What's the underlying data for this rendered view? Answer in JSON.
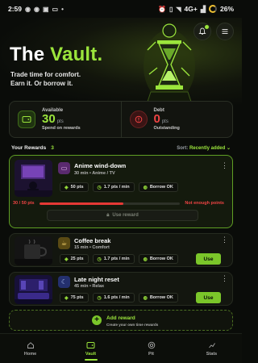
{
  "status_bar": {
    "time": "2:59",
    "signal": "4G+",
    "battery": "26%"
  },
  "hero": {
    "title_main": "The ",
    "title_accent": "Vault.",
    "subtitle_line1": "Trade time for comfort.",
    "subtitle_line2": "Earn it. Or borrow it."
  },
  "stats": {
    "available": {
      "label": "Available",
      "value": "30",
      "unit": "pts",
      "caption": "Spend on rewards"
    },
    "debt": {
      "label": "Debt",
      "value": "0",
      "unit": "pts",
      "caption": "Outstanding"
    }
  },
  "rewards_header": {
    "title": "Your Rewards",
    "count": "3",
    "sort_label": "Sort: ",
    "sort_value": "Recently added"
  },
  "rewards": [
    {
      "title": "Anime wind-down",
      "meta": "30 min • Anime / TV",
      "cost": "50 pts",
      "rate": "1.7 pts / min",
      "borrow": "Borrow OK",
      "progress_text": "30 / 50 pts",
      "progress_fraction": 0.6,
      "warning": "Not enough points",
      "action": "Use reward"
    },
    {
      "title": "Coffee break",
      "meta": "15 min • Comfort",
      "cost": "25 pts",
      "rate": "1.7 pts / min",
      "borrow": "Borrow OK",
      "action": "Use"
    },
    {
      "title": "Late night reset",
      "meta": "45 min • Relax",
      "cost": "75 pts",
      "rate": "1.6 pts / min",
      "borrow": "Borrow OK",
      "action": "Use"
    }
  ],
  "add_reward": {
    "title": "Add reward",
    "subtitle": "Create your own time rewards"
  },
  "nav": [
    {
      "label": "Home"
    },
    {
      "label": "Vault"
    },
    {
      "label": "Pit"
    },
    {
      "label": "Stats"
    }
  ],
  "colors": {
    "accent": "#9be53c",
    "danger": "#ef4444",
    "background": "#0a0c09"
  }
}
